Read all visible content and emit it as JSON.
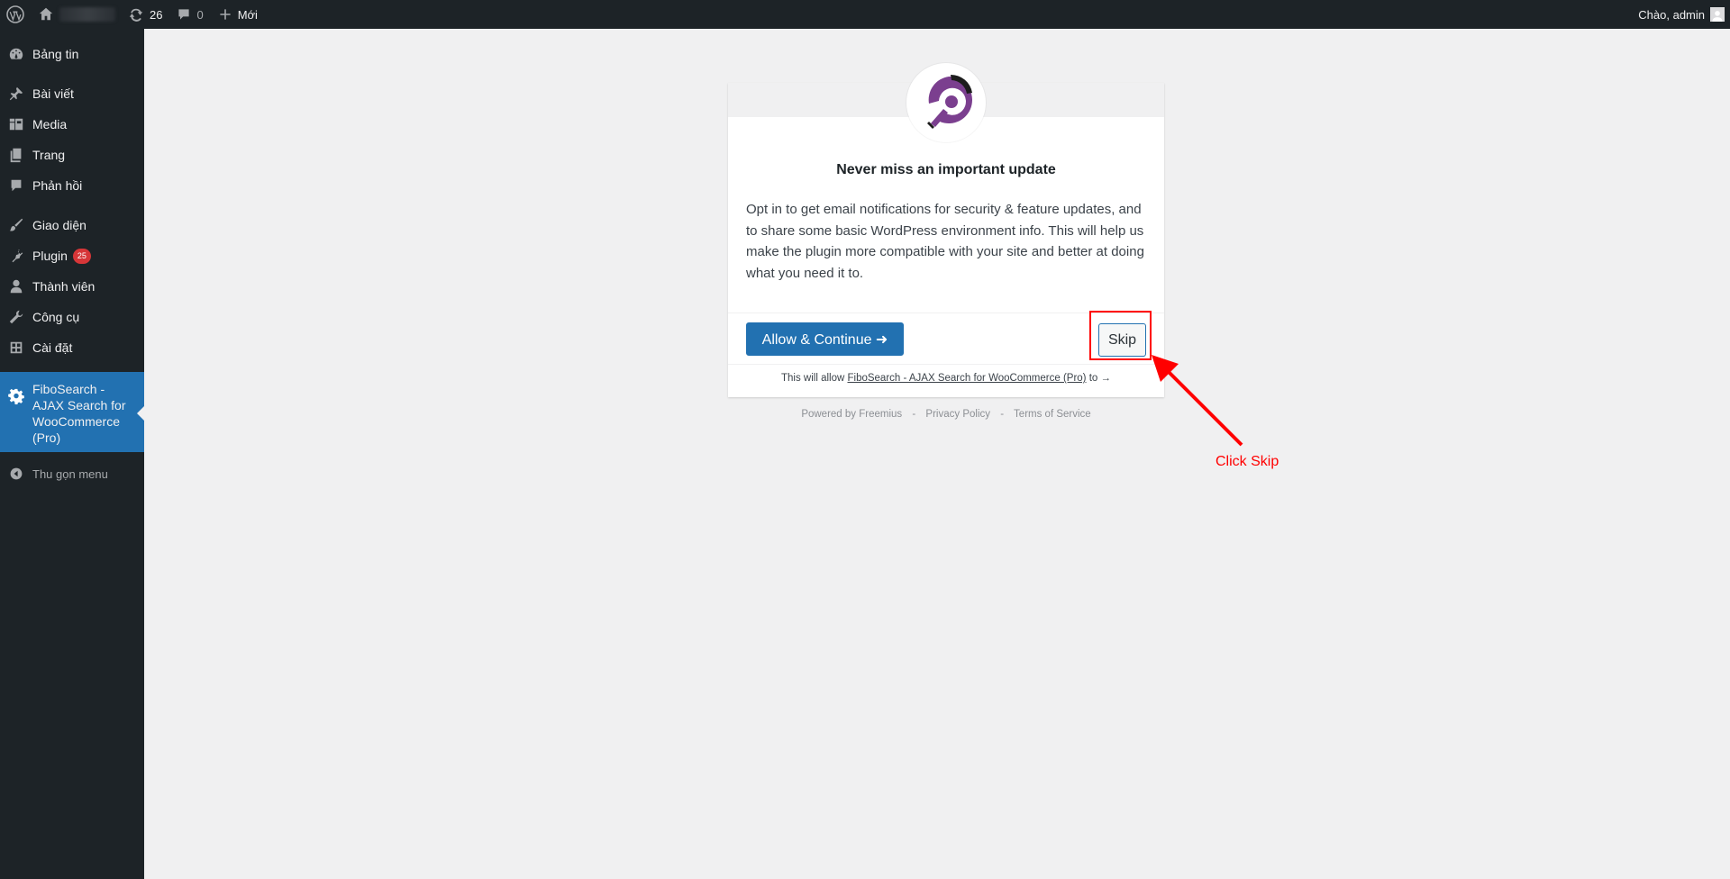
{
  "adminbar": {
    "updates_count": "26",
    "comments_count": "0",
    "new_label": "Mới",
    "greeting": "Chào, admin"
  },
  "sidebar": {
    "items": [
      {
        "label": "Bảng tin"
      },
      {
        "label": "Bài viết"
      },
      {
        "label": "Media"
      },
      {
        "label": "Trang"
      },
      {
        "label": "Phản hồi"
      },
      {
        "label": "Giao diện"
      },
      {
        "label": "Plugin",
        "badge": "25"
      },
      {
        "label": "Thành viên"
      },
      {
        "label": "Công cụ"
      },
      {
        "label": "Cài đặt"
      },
      {
        "label": "FiboSearch - AJAX Search for WooCommerce (Pro)"
      }
    ],
    "collapse_label": "Thu gọn menu"
  },
  "optin": {
    "title": "Never miss an important update",
    "text": "Opt in to get email notifications for security & feature updates, and to share some basic WordPress environment info. This will help us make the plugin more compatible with your site and better at doing what you need it to.",
    "allow_button": "Allow & Continue ➜",
    "skip_button": "Skip",
    "permissions_prefix": "This will allow",
    "permissions_plugin": "FiboSearch - AJAX Search for WooCommerce (Pro)",
    "permissions_suffix": "to →"
  },
  "footer": {
    "powered_by": "Powered by Freemius",
    "separator": "-",
    "privacy": "Privacy Policy",
    "terms": "Terms of Service"
  },
  "annotation": {
    "label": "Click Skip",
    "color": "#ff0000"
  },
  "colors": {
    "adminbar_bg": "#1d2327",
    "accent": "#2271b1",
    "badge": "#d63638",
    "logo_purple": "#7b3f8f"
  }
}
